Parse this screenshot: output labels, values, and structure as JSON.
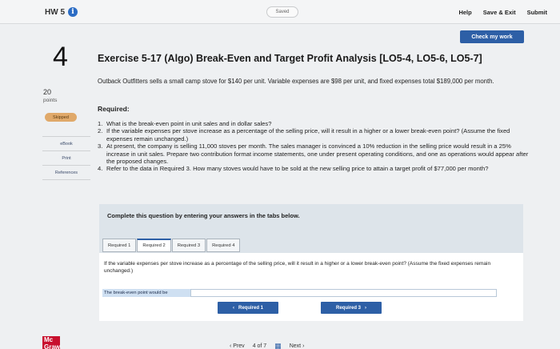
{
  "header": {
    "hw_label": "HW 5",
    "info_icon": "i",
    "status": "Saved",
    "links": [
      "Help",
      "Save & Exit",
      "Submit"
    ],
    "check_button": "Check my work"
  },
  "sidebar": {
    "question_number": "4",
    "points_value": "20",
    "points_label": "points",
    "status_badge": "Skipped",
    "links": [
      "eBook",
      "Print",
      "References"
    ]
  },
  "exercise": {
    "title": "Exercise 5-17 (Algo) Break-Even and Target Profit Analysis [LO5-4, LO5-6, LO5-7]",
    "description": "Outback Outfitters sells a small camp stove for $140 per unit. Variable expenses are $98 per unit, and fixed expenses total $189,000 per month.",
    "required_heading": "Required:",
    "questions": [
      {
        "num": "1.",
        "text": "What is the break-even point in unit sales and in dollar sales?"
      },
      {
        "num": "2.",
        "text": "If the variable expenses per stove increase as a percentage of the selling price, will it result in a higher or a lower break-even point? (Assume the fixed expenses remain unchanged.)"
      },
      {
        "num": "3.",
        "text": "At present, the company is selling 11,000 stoves per month. The sales manager is convinced a 10% reduction in the selling price would result in a 25% increase in unit sales. Prepare two contribution format income statements, one under present operating conditions, and one as operations would appear after the proposed changes."
      },
      {
        "num": "4.",
        "text": "Refer to the data in Required 3. How many stoves would have to be sold at the new selling price to attain a target profit of $77,000 per month?"
      }
    ]
  },
  "answer_panel": {
    "instruction": "Complete this question by entering your answers in the tabs below.",
    "tabs": [
      "Required 1",
      "Required 2",
      "Required 3",
      "Required 4"
    ],
    "active_tab": "Required 2",
    "question_text": "If the variable expenses per stove increase as a percentage of the selling price, will it result in a higher or a lower break-even point? (Assume the fixed expenses remain unchanged.)",
    "answer_label": "The break-even point would be",
    "answer_value": "",
    "prev_button": "Required 1",
    "next_button": "Required 3"
  },
  "footer": {
    "logo_text": "Mc Graw",
    "prev_label": "Prev",
    "page_indicator": "4 of 7",
    "next_label": "Next"
  },
  "colors": {
    "accent": "#2d5fa6",
    "skipped_badge": "#e0a96a",
    "panel_bg": "#dde4ea",
    "brand_red": "#c8102e"
  }
}
